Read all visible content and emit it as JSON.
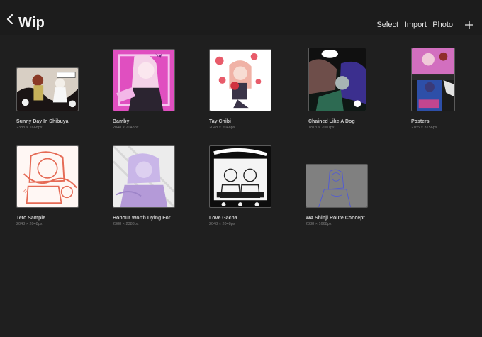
{
  "header": {
    "title": "Wip",
    "actions": {
      "select": "Select",
      "import": "Import",
      "photo": "Photo"
    }
  },
  "artworks": [
    {
      "name": "Sunny Day In Shibuya",
      "dims": "2388 × 1668px"
    },
    {
      "name": "Bamby",
      "dims": "2048 × 2048px"
    },
    {
      "name": "Tay Chibi",
      "dims": "2048 × 2048px"
    },
    {
      "name": "Chained Like A Dog",
      "dims": "1813 × 2001px"
    },
    {
      "name": "Posters",
      "dims": "2165 × 3156px"
    },
    {
      "name": "Teto Sample",
      "dims": "2048 × 2048px"
    },
    {
      "name": "Honour Worth Dying For",
      "dims": "2388 × 2388px"
    },
    {
      "name": "Love Gacha",
      "dims": "2048 × 2048px"
    },
    {
      "name": "WA Shinji Route Concept",
      "dims": "2388 × 1668px"
    }
  ]
}
